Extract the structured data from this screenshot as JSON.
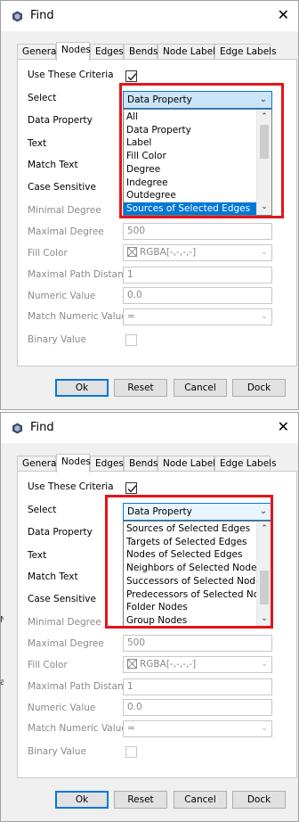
{
  "dialogs": [
    {
      "title": "Find",
      "tabs": [
        "General",
        "Nodes",
        "Edges",
        "Bends",
        "Node Labels",
        "Edge Labels"
      ],
      "active_tab": "Nodes",
      "labels": {
        "use_criteria": "Use These Criteria",
        "select": "Select",
        "data_property": "Data Property",
        "text": "Text",
        "match_text": "Match Text",
        "case_sensitive": "Case Sensitive",
        "minimal_degree": "Minimal Degree",
        "maximal_degree": "Maximal Degree",
        "fill_color": "Fill Color",
        "max_path_distance": "Maximal Path Distance",
        "numeric_value": "Numeric Value",
        "match_numeric_value": "Match Numeric Value",
        "binary_value": "Binary Value"
      },
      "use_criteria_checked": true,
      "select_value": "Data Property",
      "dropdown_options": [
        "All",
        "Data Property",
        "Label",
        "Fill Color",
        "Degree",
        "Indegree",
        "Outdegree",
        "Sources of Selected Edges"
      ],
      "selected_option": "Sources of Selected Edges",
      "fields": {
        "maximal_degree": "500",
        "fill_color": "RGBA[-,-,-,-]",
        "max_path_distance": "1",
        "numeric_value": "0.0",
        "match_numeric_value": "="
      },
      "buttons": [
        "Ok",
        "Reset",
        "Cancel",
        "Dock"
      ]
    },
    {
      "title": "Find",
      "tabs": [
        "General",
        "Nodes",
        "Edges",
        "Bends",
        "Node Labels",
        "Edge Labels"
      ],
      "active_tab": "Nodes",
      "labels": {
        "use_criteria": "Use These Criteria",
        "select": "Select",
        "data_property": "Data Property",
        "text": "Text",
        "match_text": "Match Text",
        "case_sensitive": "Case Sensitive",
        "minimal_degree": "Minimal Degree",
        "maximal_degree": "Maximal Degree",
        "fill_color": "Fill Color",
        "max_path_distance": "Maximal Path Distance",
        "numeric_value": "Numeric Value",
        "match_numeric_value": "Match Numeric Value",
        "binary_value": "Binary Value"
      },
      "use_criteria_checked": true,
      "select_value": "Data Property",
      "dropdown_options": [
        "Sources of Selected Edges",
        "Targets of Selected Edges",
        "Nodes of Selected Edges",
        "Neighbors of Selected Nodes",
        "Successors of Selected Nodes",
        "Predecessors of Selected Nodes",
        "Folder Nodes",
        "Group Nodes"
      ],
      "selected_option": "",
      "fields": {
        "maximal_degree": "500",
        "fill_color": "RGBA[-,-,-,-]",
        "max_path_distance": "1",
        "numeric_value": "0.0",
        "match_numeric_value": "="
      },
      "buttons": [
        "Ok",
        "Reset",
        "Cancel",
        "Dock"
      ]
    }
  ],
  "background_fragments": [
    "N",
    "a"
  ],
  "colors": {
    "highlight_box": "#e3141a",
    "selection": "#0078d7",
    "combo_focus": "#cce4f7"
  },
  "icons": {
    "app": "app-hexagon-icon",
    "close": "close-icon",
    "check": "checkmark-icon",
    "dropdown": "chevron-down-icon",
    "scroll_up": "scroll-up-arrow-icon",
    "scroll_down": "scroll-down-arrow-icon",
    "color_swatch": "empty-color-swatch-icon"
  }
}
